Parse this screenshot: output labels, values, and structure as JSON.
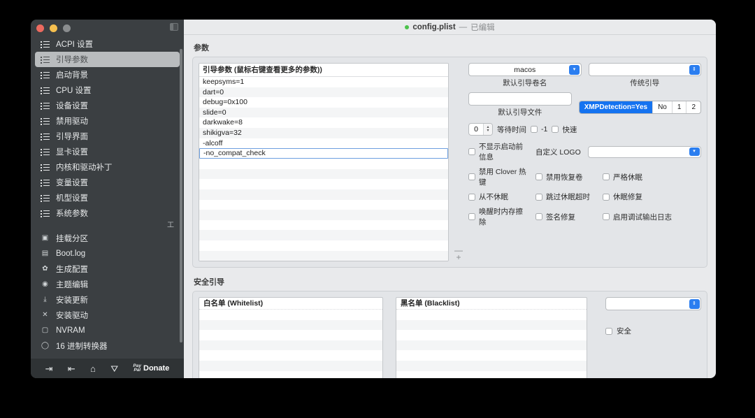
{
  "window": {
    "title": "config.plist",
    "title_separator": "—",
    "title_status": "已编辑",
    "traffic_close": "close-button",
    "traffic_minimize": "minimize-button",
    "traffic_zoom": "zoom-button"
  },
  "sidebar": {
    "items_top": [
      {
        "label": "ACPI 设置",
        "icon": "list-icon",
        "selected": false
      },
      {
        "label": "引导参数",
        "icon": "list-icon",
        "selected": true
      },
      {
        "label": "启动背景",
        "icon": "list-icon",
        "selected": false
      },
      {
        "label": "CPU 设置",
        "icon": "list-icon",
        "selected": false
      },
      {
        "label": "设备设置",
        "icon": "list-icon",
        "selected": false
      },
      {
        "label": "禁用驱动",
        "icon": "list-icon",
        "selected": false
      },
      {
        "label": "引导界面",
        "icon": "list-icon",
        "selected": false
      },
      {
        "label": "显卡设置",
        "icon": "list-icon",
        "selected": false
      },
      {
        "label": "内核和驱动补丁",
        "icon": "list-icon",
        "selected": false
      },
      {
        "label": "变量设置",
        "icon": "list-icon",
        "selected": false
      },
      {
        "label": "机型设置",
        "icon": "list-icon",
        "selected": false
      },
      {
        "label": "系统参数",
        "icon": "list-icon",
        "selected": false
      }
    ],
    "tool_glyph": "工",
    "items_bottom": [
      {
        "label": "挂载分区",
        "icon": "disk-icon",
        "glyph": "▣"
      },
      {
        "label": "Boot.log",
        "icon": "log-search-icon",
        "glyph": "▤"
      },
      {
        "label": "生成配置",
        "icon": "gears-icon",
        "glyph": "✿"
      },
      {
        "label": "主题编辑",
        "icon": "palette-icon",
        "glyph": "◉"
      },
      {
        "label": "安装更新",
        "icon": "download-icon",
        "glyph": "⤓"
      },
      {
        "label": "安装驱动",
        "icon": "tools-icon",
        "glyph": "✕"
      },
      {
        "label": "NVRAM",
        "icon": "chip-icon",
        "glyph": "▢"
      },
      {
        "label": "16 进制转换器",
        "icon": "refresh-icon",
        "glyph": "◯"
      }
    ],
    "toolbar": [
      {
        "name": "import-config-icon",
        "glyph": "⇥"
      },
      {
        "name": "export-config-icon",
        "glyph": "⇤"
      },
      {
        "name": "home-icon",
        "glyph": "⌂"
      },
      {
        "name": "share-icon",
        "glyph": "⛛"
      }
    ],
    "donate": {
      "paypal_line1": "Pay",
      "paypal_line2": "Pal",
      "label": "Donate"
    }
  },
  "params_section": {
    "label": "参数",
    "list_header": "引导参数 (鼠标右键查看更多的参数))",
    "rows": [
      "keepsyms=1",
      "dart=0",
      "debug=0x100",
      "slide=0",
      "darkwake=8",
      "shikigva=32",
      "-alcoff",
      "-no_compat_check"
    ],
    "selected_row_index": 7,
    "minus_label": "—",
    "plus_label": "+"
  },
  "options": {
    "default_volume": {
      "value": "macos",
      "caption": "默认引导卷名"
    },
    "legacy_boot": {
      "value": "",
      "caption": "传统引导"
    },
    "default_loader": {
      "value": "",
      "caption": "默认引导文件"
    },
    "xmp_segments": [
      {
        "label": "XMPDetection=Yes",
        "active": true
      },
      {
        "label": "No",
        "active": false
      },
      {
        "label": "1",
        "active": false
      },
      {
        "label": "2",
        "active": false
      }
    ],
    "timeout": {
      "value": "0",
      "label": "等待时间"
    },
    "timeout_minus1": "-1",
    "fast_label": "快速",
    "hide_boot_info": "不显示启动前信息",
    "custom_logo_label": "自定义 LOGO",
    "custom_logo_value": "",
    "checkboxes": [
      [
        "禁用 Clover 热键",
        "禁用恢复卷",
        "严格休眠"
      ],
      [
        "从不休眠",
        "跳过休眠超时",
        "休眠修复"
      ],
      [
        "唤醒时内存擦除",
        "签名修复",
        "启用调试输出日志"
      ]
    ]
  },
  "secure_boot": {
    "label": "安全引导",
    "whitelist_header": "白名单 (Whitelist)",
    "blacklist_header": "黑名单 (Blacklist)",
    "policy_value": "",
    "safe_label": "安全",
    "minus_label": "—",
    "plus_label": "+"
  },
  "colors": {
    "accent_blue": "#1573f0",
    "sidebar_bg": "#3b3f42",
    "content_bg": "#e9eaec",
    "panel_bg": "#e3e5e8",
    "selection_border": "#6d9fe0",
    "status_green": "#4cc24c"
  }
}
